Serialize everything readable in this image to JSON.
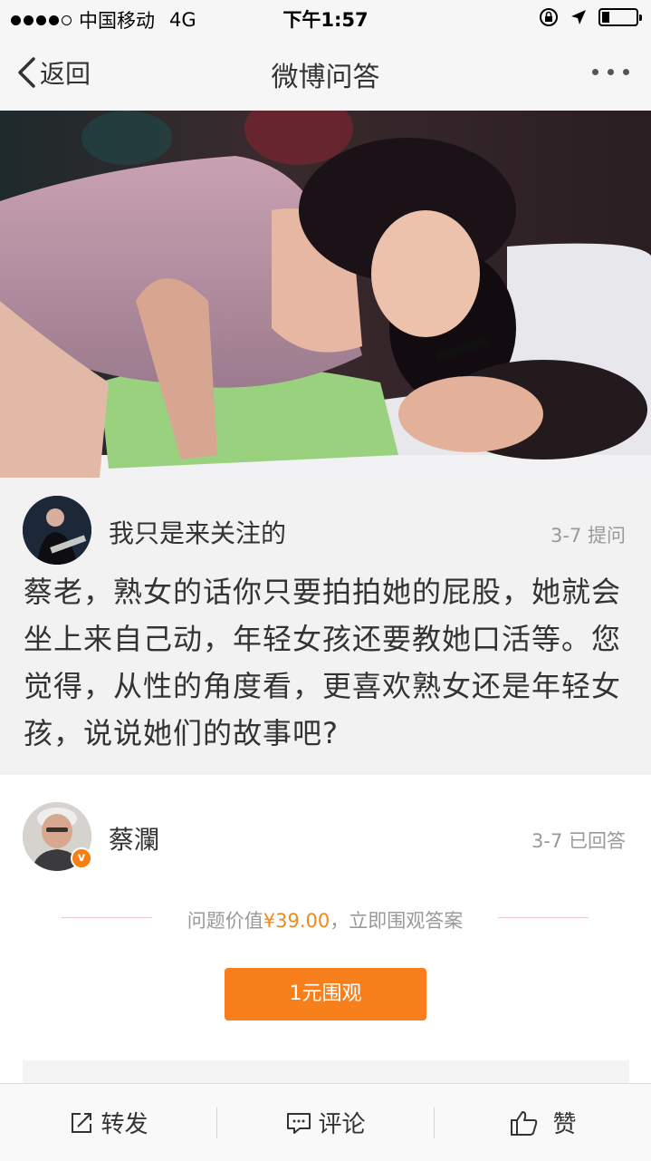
{
  "status_bar": {
    "carrier": "中国移动",
    "network": "4G",
    "time": "下午1:57"
  },
  "nav": {
    "back_label": "返回",
    "title": "微博问答"
  },
  "question": {
    "asker_name": "我只是来关注的",
    "meta": "3-7 提问",
    "text": "蔡老，熟女的话你只要拍拍她的屁股，她就会坐上来自己动，年轻女孩还要教她口活等。您觉得，从性的角度看，更喜欢熟女还是年轻女孩，说说她们的故事吧?"
  },
  "answer": {
    "answerer_name": "蔡瀾",
    "meta": "3-7 已回答",
    "value_prefix": "问题价值",
    "price": "¥39.00",
    "value_suffix": "，立即围观答案",
    "pay_button_label": "1元围观"
  },
  "toolbar": {
    "repost_label": "转发",
    "comment_label": "评论",
    "like_label": "赞"
  },
  "colors": {
    "accent_orange": "#f7801c",
    "verified_badge": "#f57e15"
  },
  "icons": [
    "back-chevron-icon",
    "more-dots-icon",
    "verified-badge-icon",
    "repost-icon",
    "comment-icon",
    "like-icon"
  ]
}
